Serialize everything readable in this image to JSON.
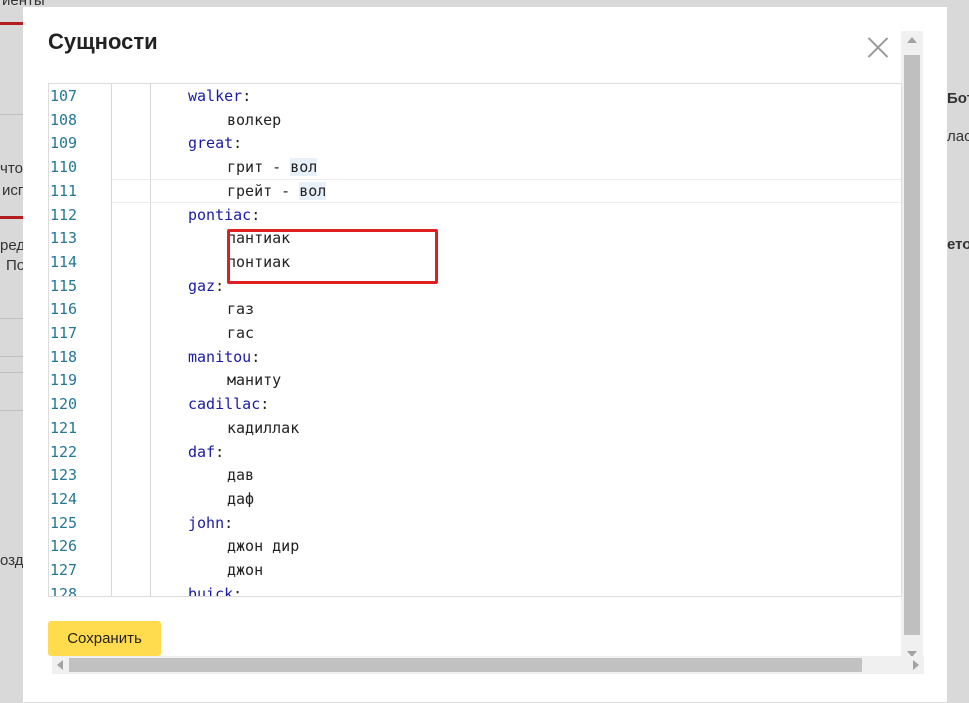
{
  "background": {
    "fragments": [
      "иенты",
      "Бот",
      "чтo",
      "ласт",
      "исп",
      "ред",
      "ето",
      "По",
      "озда"
    ]
  },
  "modal": {
    "title": "Сущности",
    "close_icon": "close-icon",
    "save_label": "Сохранить"
  },
  "editor": {
    "lines": [
      {
        "n": "107",
        "indent": 1,
        "key": "walker",
        "punc": ":",
        "text": ""
      },
      {
        "n": "108",
        "indent": 2,
        "key": "",
        "punc": "",
        "text": "волкер"
      },
      {
        "n": "109",
        "indent": 1,
        "key": "great",
        "punc": ":",
        "text": ""
      },
      {
        "n": "110",
        "indent": 2,
        "key": "",
        "punc": "",
        "text": "грит - ",
        "hl": "вол"
      },
      {
        "n": "111",
        "indent": 2,
        "key": "",
        "punc": "",
        "text": "грейт - ",
        "hl": "вол"
      },
      {
        "n": "112",
        "indent": 1,
        "key": "pontiac",
        "punc": ":",
        "text": ""
      },
      {
        "n": "113",
        "indent": 2,
        "key": "",
        "punc": "",
        "text": "пантиак"
      },
      {
        "n": "114",
        "indent": 2,
        "key": "",
        "punc": "",
        "text": "понтиак"
      },
      {
        "n": "115",
        "indent": 1,
        "key": "gaz",
        "punc": ":",
        "text": ""
      },
      {
        "n": "116",
        "indent": 2,
        "key": "",
        "punc": "",
        "text": "газ"
      },
      {
        "n": "117",
        "indent": 2,
        "key": "",
        "punc": "",
        "text": "гас"
      },
      {
        "n": "118",
        "indent": 1,
        "key": "manitou",
        "punc": ":",
        "text": ""
      },
      {
        "n": "119",
        "indent": 2,
        "key": "",
        "punc": "",
        "text": "маниту"
      },
      {
        "n": "120",
        "indent": 1,
        "key": "cadillac",
        "punc": ":",
        "text": ""
      },
      {
        "n": "121",
        "indent": 2,
        "key": "",
        "punc": "",
        "text": "кадиллак"
      },
      {
        "n": "122",
        "indent": 1,
        "key": "daf",
        "punc": ":",
        "text": ""
      },
      {
        "n": "123",
        "indent": 2,
        "key": "",
        "punc": "",
        "text": "дав"
      },
      {
        "n": "124",
        "indent": 2,
        "key": "",
        "punc": "",
        "text": "даф"
      },
      {
        "n": "125",
        "indent": 1,
        "key": "john",
        "punc": ":",
        "text": ""
      },
      {
        "n": "126",
        "indent": 2,
        "key": "",
        "punc": "",
        "text": "джон дир"
      },
      {
        "n": "127",
        "indent": 2,
        "key": "",
        "punc": "",
        "text": "джон"
      },
      {
        "n": "128",
        "indent": 1,
        "key": "buick",
        "punc": ":",
        "text": ""
      }
    ],
    "active_line": "111",
    "highlight_box_lines": [
      "110",
      "111"
    ]
  },
  "colors": {
    "accent_button": "#ffdb4d",
    "highlight_box": "#e02020",
    "key_color": "#1a1aa6",
    "line_number_color": "#237893"
  }
}
